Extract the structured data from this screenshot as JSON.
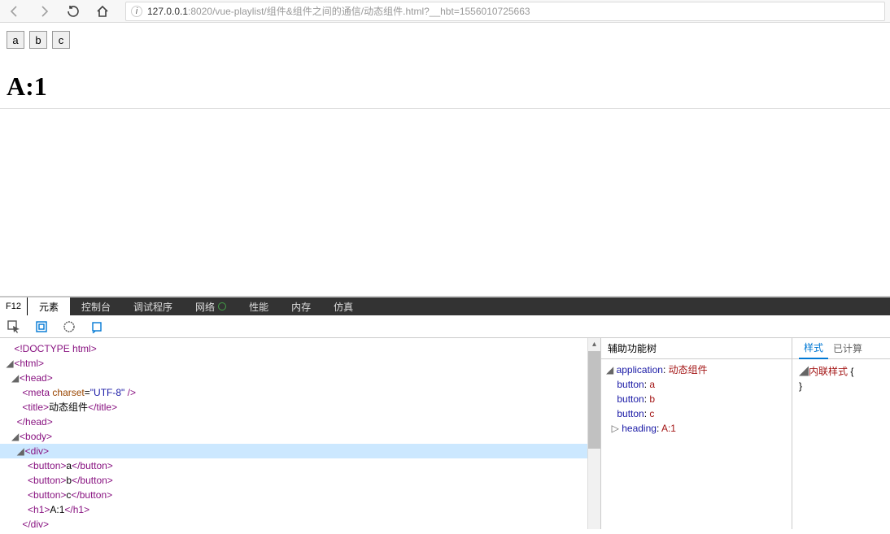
{
  "browser": {
    "url_prefix": "127.0.0.1",
    "url_suffix": ":8020/vue-playlist/组件&组件之间的通信/动态组件.html?__hbt=1556010725663"
  },
  "page": {
    "buttons": [
      "a",
      "b",
      "c"
    ],
    "heading": "A:1"
  },
  "devtools": {
    "f12": "F12",
    "tabs": {
      "elements": "元素",
      "console": "控制台",
      "debugger": "调试程序",
      "network": "网络",
      "performance": "性能",
      "memory": "内存",
      "emulation": "仿真"
    },
    "dom": {
      "doctype": "<!DOCTYPE html>",
      "html_open": "<html>",
      "head_open": "<head>",
      "meta_tag": "meta",
      "meta_attr": "charset",
      "meta_val": "\"UTF-8\"",
      "title_open": "<title>",
      "title_text": "动态组件",
      "title_close": "</title>",
      "head_close": "</head>",
      "body_open": "<body>",
      "div_open": "<div>",
      "btn_open": "<button>",
      "btn_close": "</button>",
      "btn_a": "a",
      "btn_b": "b",
      "btn_c": "c",
      "h1_open": "<h1>",
      "h1_text": "A:1",
      "h1_close": "</h1>",
      "div_close": "</div>"
    },
    "a11y": {
      "title": "辅助功能树",
      "app_role": "application",
      "app_name": "动态组件",
      "btn_role": "button",
      "btn_a": "a",
      "btn_b": "b",
      "btn_c": "c",
      "heading_role": "heading",
      "heading_name": "A:1"
    },
    "styles": {
      "tabs": {
        "styles": "样式",
        "computed": "已计算",
        "more": ""
      },
      "inline_rule": "内联样式",
      "brace_open": "{",
      "brace_close": "}"
    }
  }
}
